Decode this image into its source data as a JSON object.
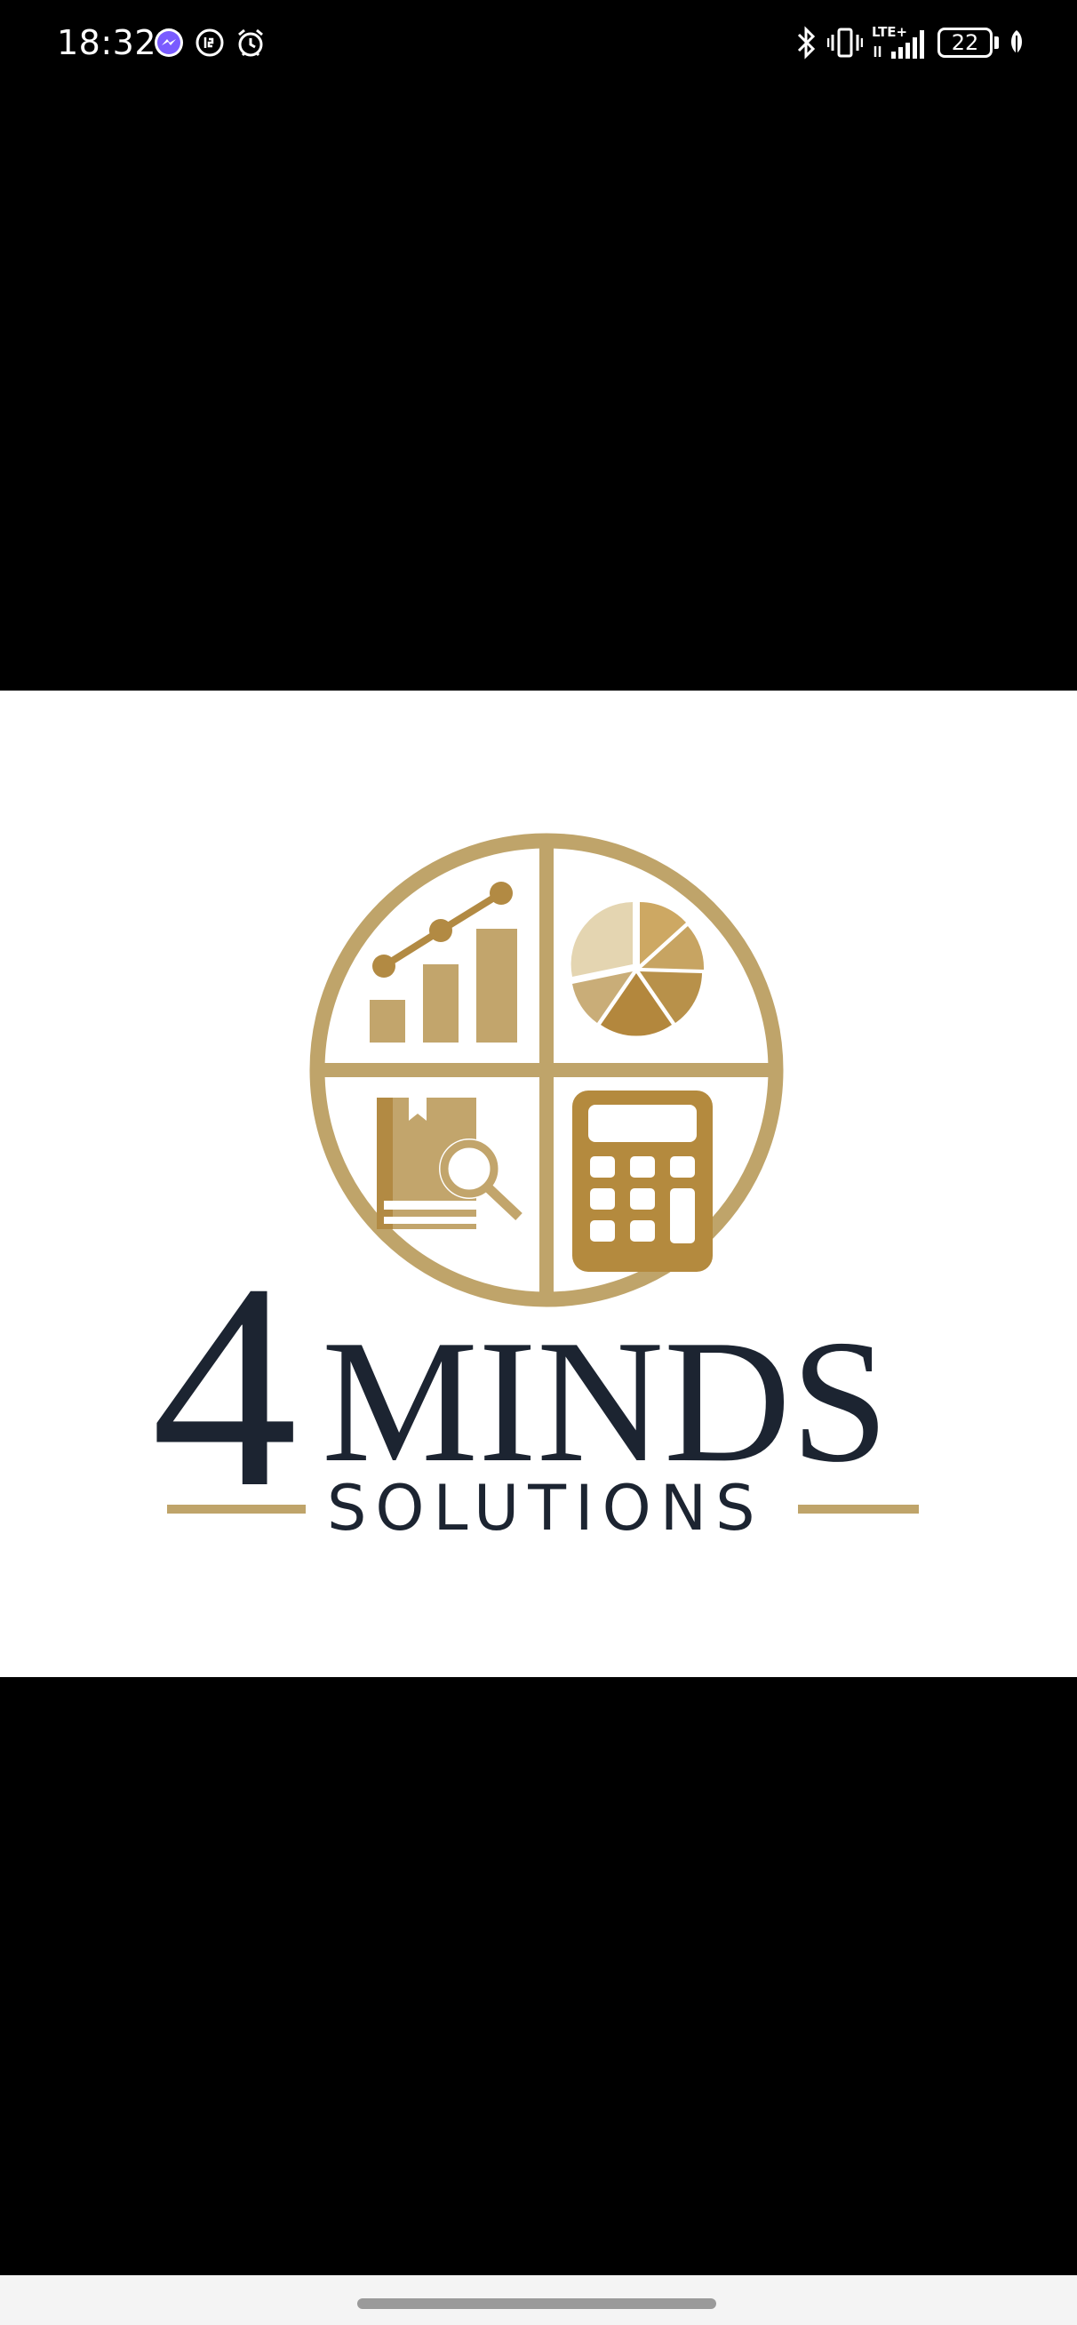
{
  "status_bar": {
    "time": "18:32",
    "battery_level": "22",
    "network_label": "LTE+",
    "left_icons": [
      "messenger-icon",
      "data-saver-icon",
      "alarm-icon"
    ],
    "right_icons": [
      "bluetooth-icon",
      "vibrate-icon",
      "lte-signal-icon",
      "battery-icon",
      "battery-saver-leaf-icon"
    ]
  },
  "image": {
    "logo_number": "4",
    "logo_word": "MINDS",
    "logo_tagline": "SOLUTIONS",
    "emblem_quadrants": [
      "bar-chart-trend-icon",
      "pie-chart-icon",
      "book-magnifier-icon",
      "calculator-icon"
    ]
  },
  "colors": {
    "gold": "#bfa46a",
    "gold_dark": "#b48a3e",
    "gold_light": "#e4d5b1",
    "navy": "#1c2431",
    "background": "#000000",
    "image_background": "#ffffff"
  }
}
